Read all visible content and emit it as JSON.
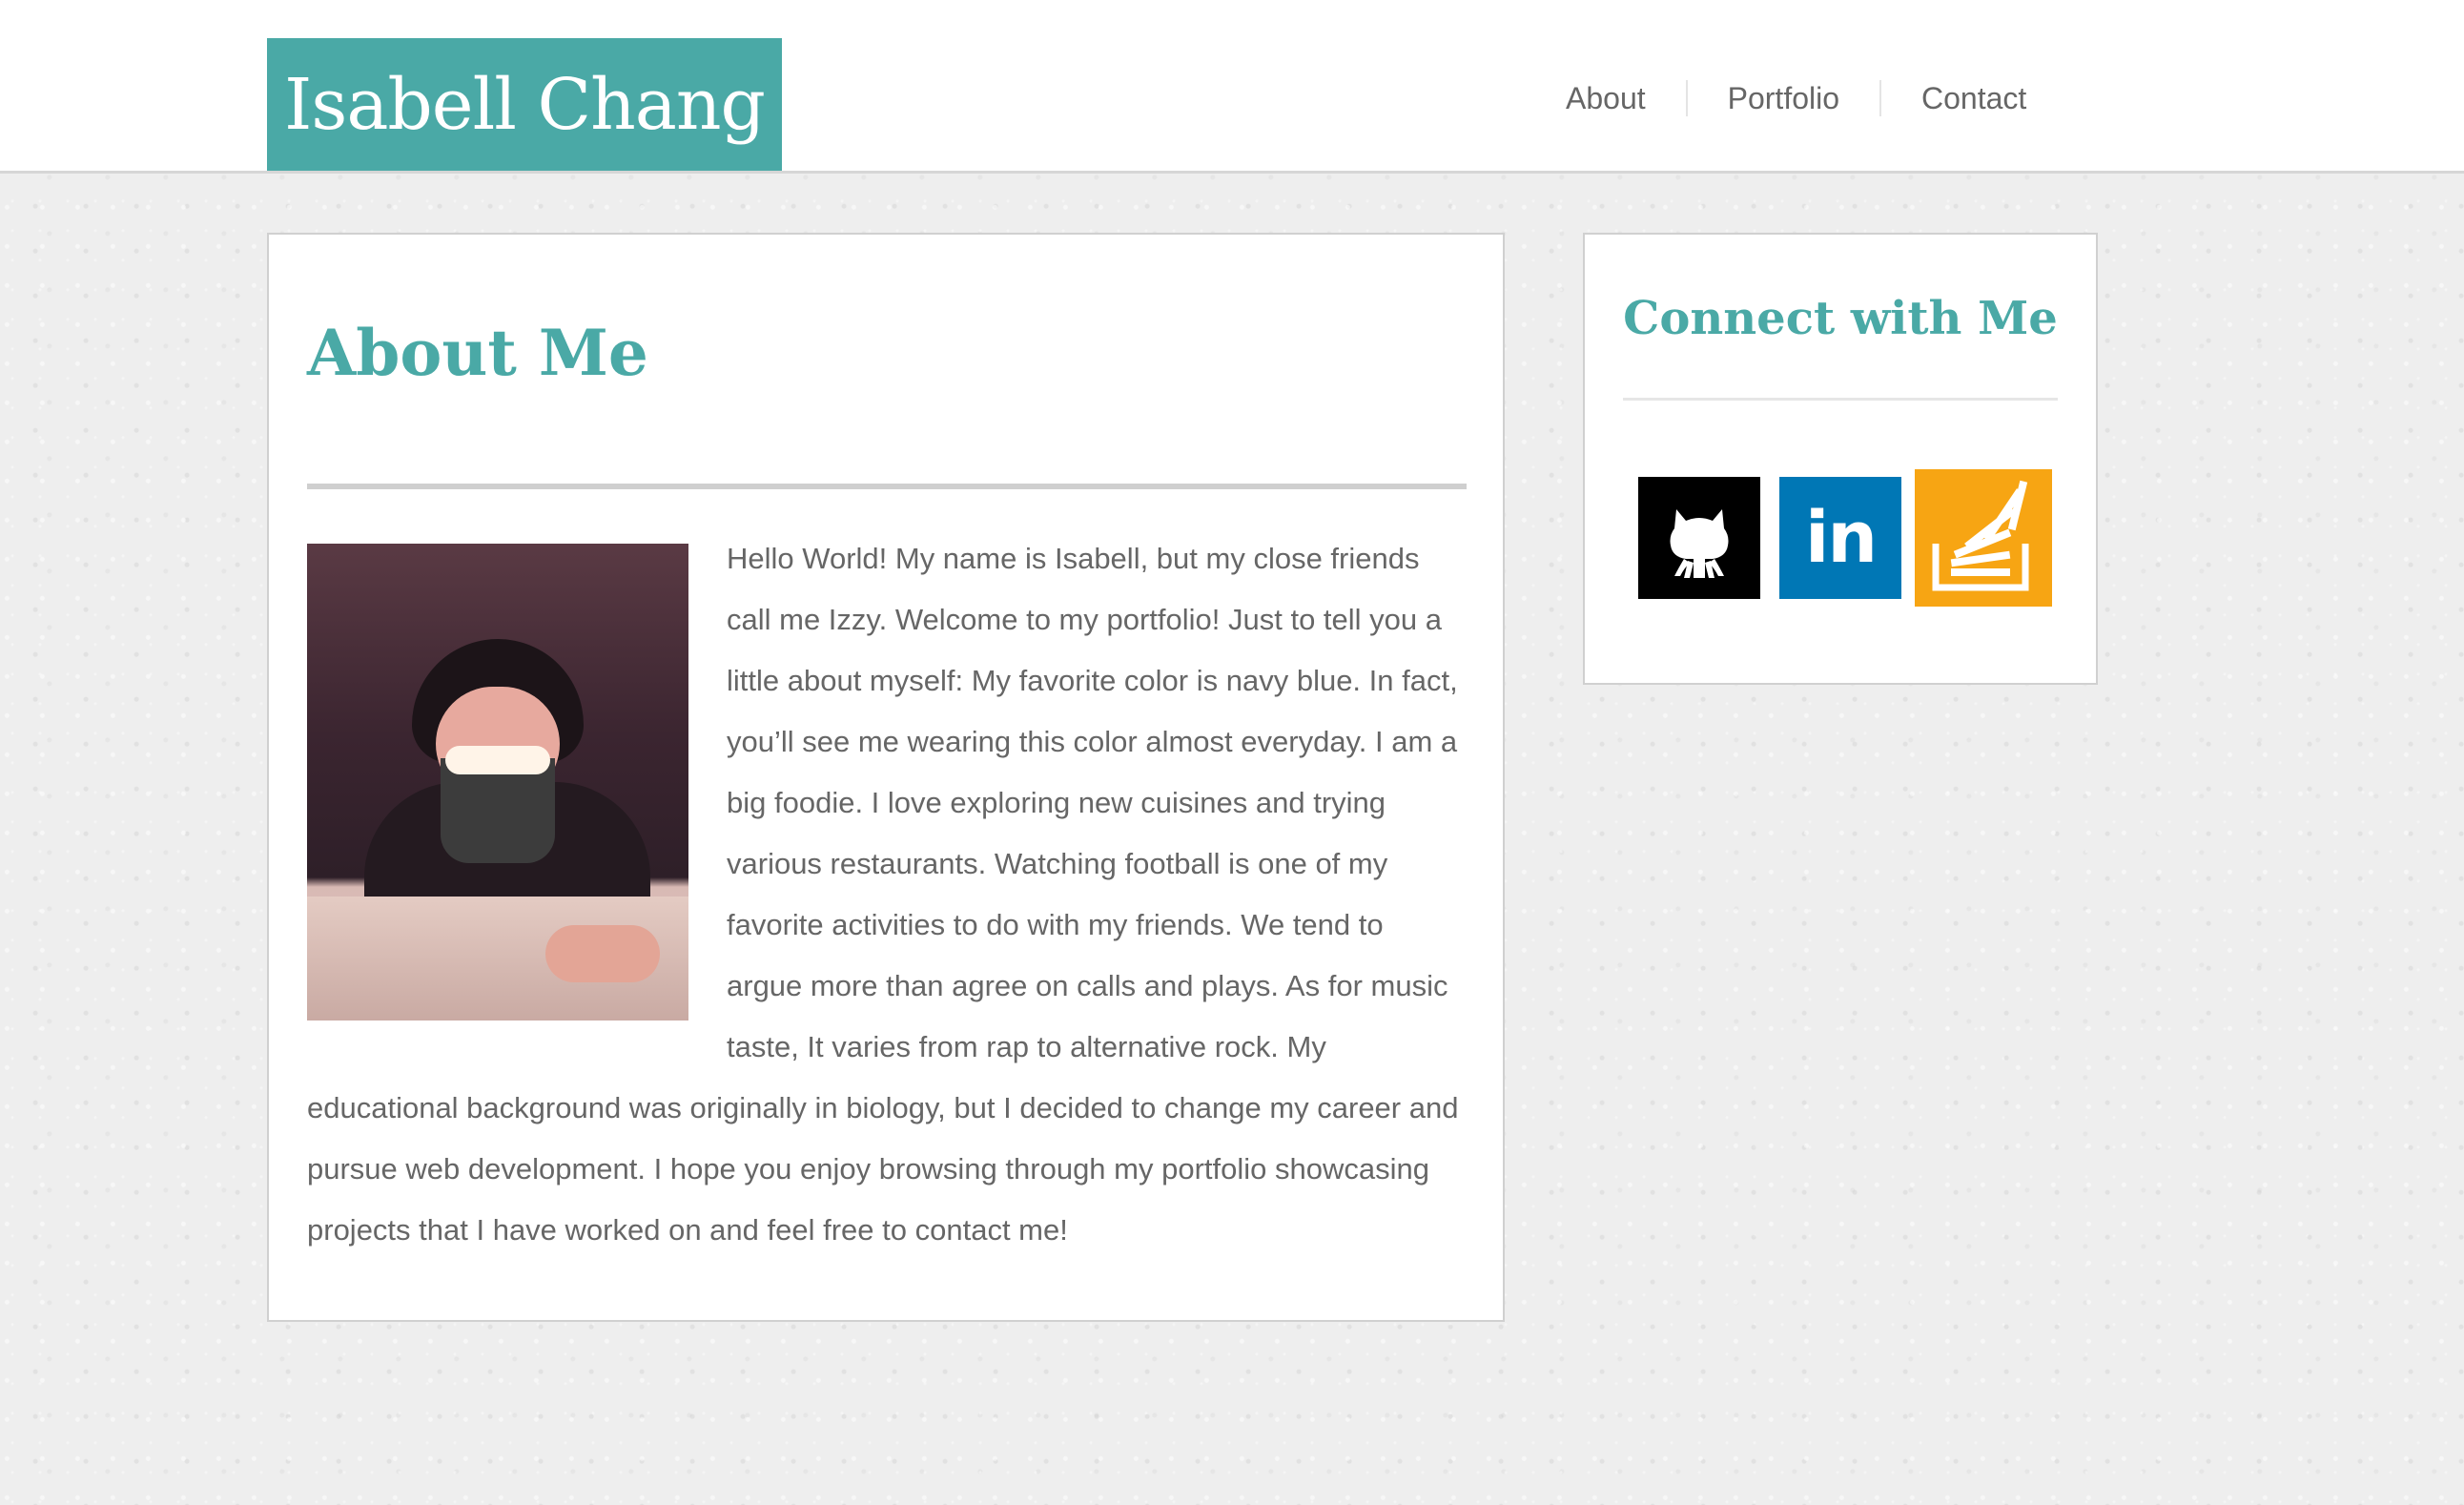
{
  "site": {
    "name": "Isabell Chang",
    "accent_color": "#4aa9a6"
  },
  "nav": {
    "items": [
      {
        "label": "About"
      },
      {
        "label": "Portfolio"
      },
      {
        "label": "Contact"
      }
    ]
  },
  "about": {
    "title": "About Me",
    "photo_icon": "profile-photo",
    "body": "Hello World! My name is Isabell, but my close friends call me Izzy. Welcome to my portfolio! Just to tell you a little about myself: My favorite color is navy blue. In fact, you’ll see me wearing this color almost everyday. I am a big foodie. I love exploring new cuisines and trying various restaurants. Watching football is one of my favorite activities to do with my friends. We tend to argue more than agree on calls and plays. As for music taste, It varies from rap to alternative rock. My educational background was originally in biology, but I decided to change my career and pursue web development. I hope you enjoy browsing through my portfolio showcasing projects that I have worked on and feel free to contact me!"
  },
  "connect": {
    "title": "Connect with Me",
    "links": [
      {
        "icon": "github-icon",
        "color": "#000000"
      },
      {
        "icon": "linkedin-icon",
        "label": "in",
        "color": "#0077b5"
      },
      {
        "icon": "stackoverflow-icon",
        "color": "#f7a513"
      }
    ]
  }
}
